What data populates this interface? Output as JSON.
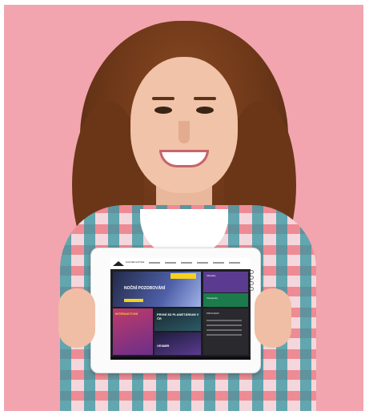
{
  "tablet_site": {
    "logo_text": "Hvězdárna Praha",
    "hero": {
      "title": "NOČNÍ POZOROVÁNÍ"
    },
    "side_panel": {
      "purple_text": "Aktuality",
      "green_text": "Vstupenky"
    },
    "tiles": [
      {
        "label": "INTERAKTIVNÍ"
      },
      {
        "label": "PRVNÍ 3D PLANETÁRIUM V ČR"
      },
      {
        "label": "VESMÍR"
      },
      {
        "label": "PROGRAM"
      }
    ]
  },
  "colors": {
    "background": "#f2a5ae",
    "accent_yellow": "#f6d21c",
    "purple": "#5b3b8f",
    "green": "#1b7b4c"
  }
}
